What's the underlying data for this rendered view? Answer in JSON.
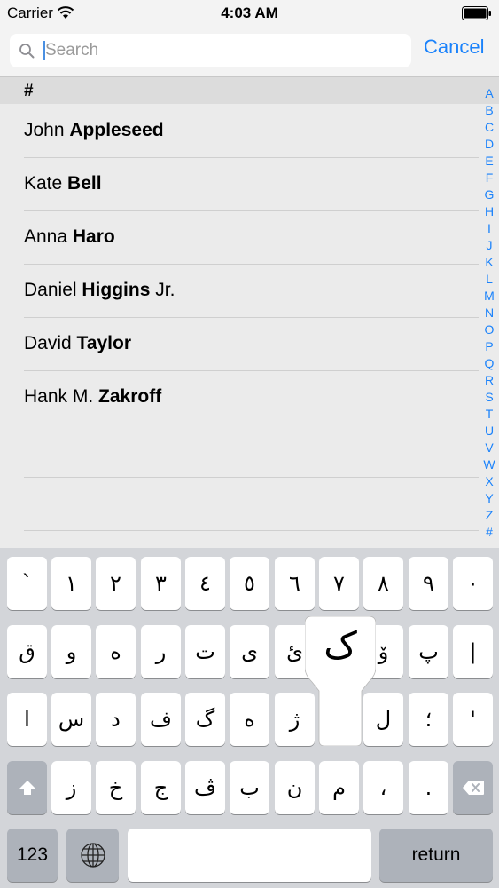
{
  "status_bar": {
    "carrier": "Carrier",
    "time": "4:03 AM"
  },
  "search": {
    "placeholder": "Search",
    "value": "",
    "cancel_label": "Cancel"
  },
  "contacts": {
    "section_header": "#",
    "rows": [
      {
        "first": "John",
        "last": "Appleseed",
        "suffix": ""
      },
      {
        "first": "Kate",
        "last": "Bell",
        "suffix": ""
      },
      {
        "first": "Anna",
        "last": "Haro",
        "suffix": ""
      },
      {
        "first": "Daniel",
        "last": "Higgins",
        "suffix": "Jr."
      },
      {
        "first": "David",
        "last": "Taylor",
        "suffix": ""
      },
      {
        "first": "Hank M.",
        "last": "Zakroff",
        "suffix": ""
      }
    ]
  },
  "index_letters": [
    "A",
    "B",
    "C",
    "D",
    "E",
    "F",
    "G",
    "H",
    "I",
    "J",
    "K",
    "L",
    "M",
    "N",
    "O",
    "P",
    "Q",
    "R",
    "S",
    "T",
    "U",
    "V",
    "W",
    "X",
    "Y",
    "Z",
    "#"
  ],
  "keyboard": {
    "row1": [
      "`",
      "١",
      "٢",
      "٣",
      "٤",
      "٥",
      "٦",
      "٧",
      "٨",
      "٩",
      "٠"
    ],
    "row2": [
      "ق",
      "و",
      "ه",
      "ر",
      "ت",
      "ی",
      "ئ",
      "",
      "ۆ",
      "پ",
      "|"
    ],
    "row3": [
      "ا",
      "س",
      "د",
      "ف",
      "گ",
      "ه",
      "ژ",
      "",
      "ل",
      "؛",
      "'"
    ],
    "row4": [
      "ز",
      "خ",
      "ج",
      "ڤ",
      "ب",
      "ن",
      "م",
      "،",
      "."
    ],
    "numbers_label": "123",
    "return_label": "return",
    "popup_char": "ک"
  },
  "colors": {
    "accent": "#1a82fb",
    "keyboard_bg": "#d3d5d9",
    "list_bg": "#ebebeb"
  }
}
